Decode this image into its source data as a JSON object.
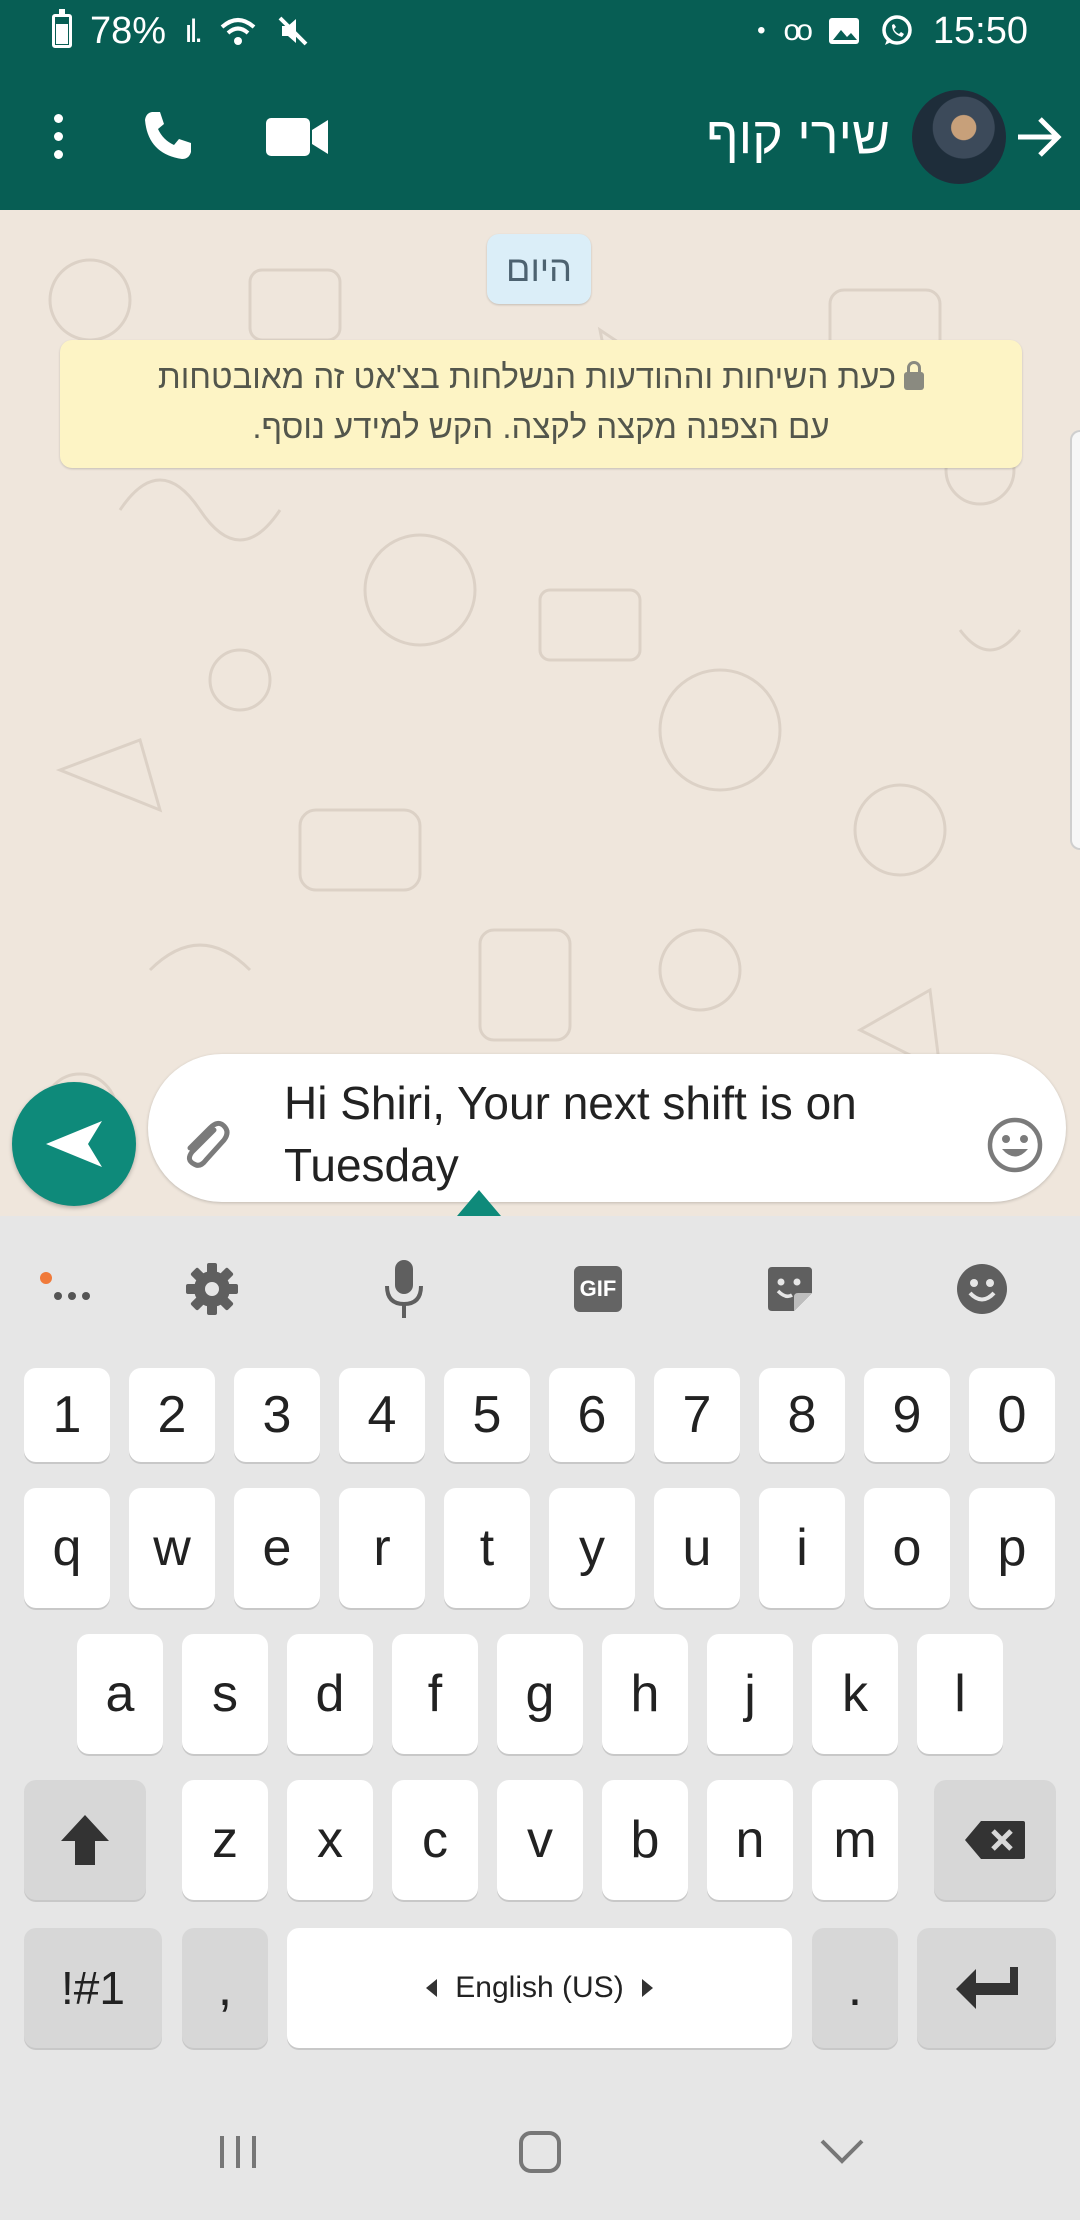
{
  "status_bar": {
    "battery": "78%",
    "time": "15:50",
    "dot": "•",
    "voicemail": "oo"
  },
  "header": {
    "contact_name": "שירי קוף"
  },
  "chat": {
    "date_chip": "היום",
    "encryption_line1": "כעת השיחות וההודעות הנשלחות בצ'אט זה מאובטחות",
    "encryption_line2": "עם הצפנה מקצה לקצה. הקש למידע נוסף."
  },
  "composer": {
    "message_line1": "Hi Shiri, Your next shift is on",
    "message_line2": "Tuesday"
  },
  "keyboard": {
    "toolbar": {
      "gif_label": "GIF"
    },
    "number_row": [
      "1",
      "2",
      "3",
      "4",
      "5",
      "6",
      "7",
      "8",
      "9",
      "0"
    ],
    "row1": [
      "q",
      "w",
      "e",
      "r",
      "t",
      "y",
      "u",
      "i",
      "o",
      "p"
    ],
    "row2": [
      "a",
      "s",
      "d",
      "f",
      "g",
      "h",
      "j",
      "k",
      "l"
    ],
    "row3": [
      "z",
      "x",
      "c",
      "v",
      "b",
      "n",
      "m"
    ],
    "symbols_label": "!#1",
    "comma_label": ",",
    "space_label": "English (US)",
    "period_label": "."
  },
  "colors": {
    "header_bg": "#075e54",
    "send_button": "#0e8a7a",
    "notice_bg": "#fdf4c5",
    "date_chip_bg": "#dbeef8"
  }
}
